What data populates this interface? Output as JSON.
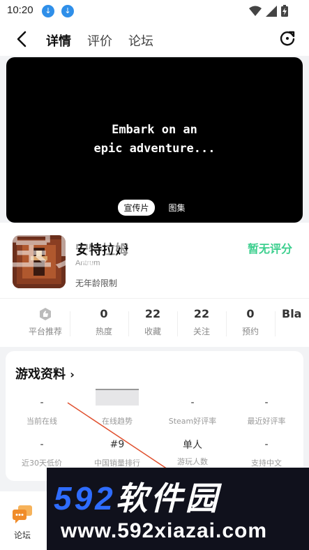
{
  "status_bar": {
    "time": "10:20"
  },
  "nav": {
    "tabs": [
      "详情",
      "评价",
      "论坛"
    ]
  },
  "media": {
    "caption_line1": "Embark on an",
    "caption_line2": "epic adventure...",
    "tabs": [
      "宣传片",
      "图集"
    ]
  },
  "game": {
    "title": "安特拉姆",
    "subtitle": "Antrum",
    "age_rating": "无年龄限制",
    "score_label": "暂无评分",
    "watermark": "宝贝游戏网"
  },
  "stats": [
    {
      "value": "",
      "label": "平台推荐"
    },
    {
      "value": "0",
      "label": "热度"
    },
    {
      "value": "22",
      "label": "收藏"
    },
    {
      "value": "22",
      "label": "关注"
    },
    {
      "value": "0",
      "label": "预约"
    },
    {
      "value": "Bla",
      "label": ""
    }
  ],
  "data_card": {
    "heading": "游戏资料",
    "row1": [
      {
        "value": "-",
        "label": "当前在线"
      },
      {
        "value": "",
        "label": "在线趋势"
      },
      {
        "value": "-",
        "label": "Steam好评率"
      },
      {
        "value": "-",
        "label": "最近好评率"
      }
    ],
    "row2": [
      {
        "value": "-",
        "label": "近30天低价"
      },
      {
        "value": "#9",
        "label": "中国销量排行"
      },
      {
        "value": "单人",
        "label": "游玩人数"
      },
      {
        "value": "-",
        "label": "支持中文"
      }
    ]
  },
  "bottom": {
    "forum_label": "论坛"
  },
  "banner": {
    "brand_number": "592",
    "brand_text": "软件园",
    "url": "www.592xiazai.com"
  },
  "colors": {
    "accent": "#35d39a",
    "brand_blue": "#2e6cff"
  }
}
